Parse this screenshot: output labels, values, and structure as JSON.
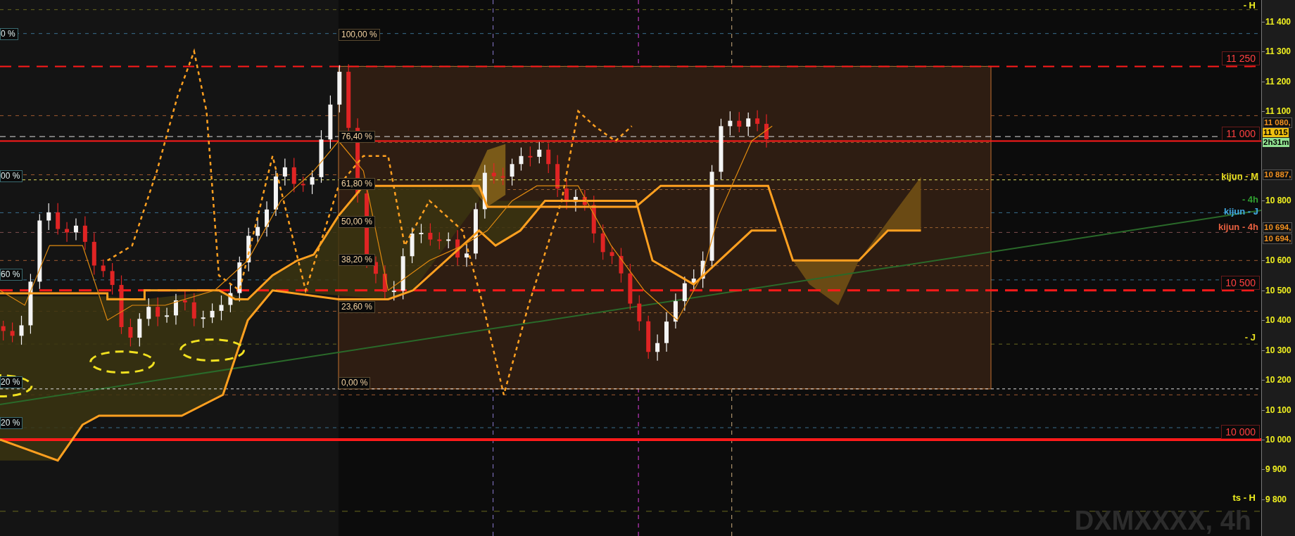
{
  "chart": {
    "symbol": "DXMXXXX, 4h"
  },
  "price_axis": {
    "ticks": [
      "11 400",
      "11 300",
      "11 200",
      "11 100",
      "10 800",
      "10 600",
      "10 500",
      "10 400",
      "10 300",
      "10 200",
      "10 100",
      "10 000",
      "9 900",
      "9 800"
    ]
  },
  "axis_tags": [
    {
      "text": "11 080,",
      "kind": "line"
    },
    {
      "text": "11 015",
      "kind": "last"
    },
    {
      "text": "2h31m",
      "kind": "timer"
    },
    {
      "text": "10 887,",
      "kind": "line"
    },
    {
      "text": "10 694,",
      "kind": "line"
    },
    {
      "text": "10 694,",
      "kind": "line"
    }
  ],
  "level_labels": [
    "11 250",
    "11 000",
    "10 500",
    "10 000"
  ],
  "line_labels": [
    {
      "text": "- H",
      "color": "#f0f020"
    },
    {
      "text": "kijun - M",
      "color": "#e8e020"
    },
    {
      "text": "- 4h",
      "color": "#30a030"
    },
    {
      "text": "kijun - J",
      "color": "#40a8e0"
    },
    {
      "text": "kijun - 4h",
      "color": "#e86040"
    },
    {
      "text": "- J",
      "color": "#e8e020"
    },
    {
      "text": "ts - H",
      "color": "#f0f020"
    }
  ],
  "fib_labels": [
    "100,00 %",
    "76,40 %",
    "61,80 %",
    "50,00 %",
    "38,20 %",
    "23,60 %",
    "0,00 %"
  ],
  "left_labels": [
    "0 %",
    "00 %",
    "60 %",
    "20 %",
    "20 %"
  ]
}
